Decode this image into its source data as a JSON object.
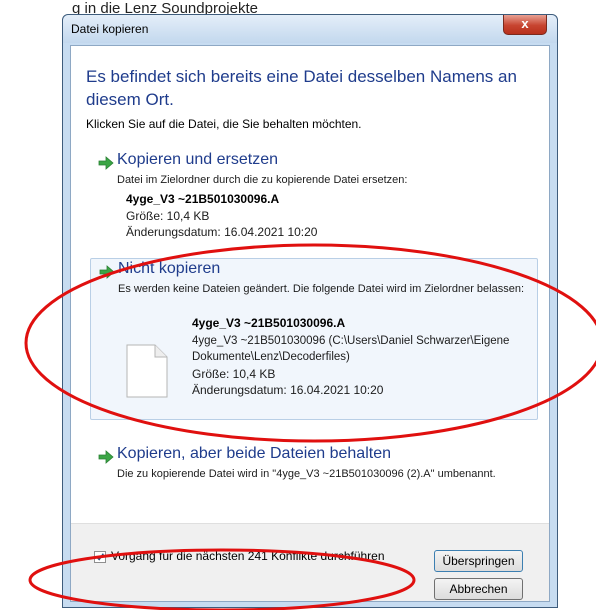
{
  "background": {
    "text": "g in die Lenz Soundprojekte"
  },
  "dialog": {
    "title": "Datei kopieren",
    "close_glyph": "x",
    "heading": "Es befindet sich bereits eine Datei desselben Namens an diesem Ort.",
    "subheading": "Klicken Sie auf die Datei, die Sie behalten möchten.",
    "options": [
      {
        "title": "Kopieren und ersetzen",
        "description": "Datei im Zielordner durch die zu kopierende Datei ersetzen:",
        "file_name": "4yge_V3 ~21B501030096.A",
        "size": "Größe: 10,4 KB",
        "modified": "Änderungsdatum: 16.04.2021 10:20"
      },
      {
        "title": "Nicht kopieren",
        "description": "Es werden keine Dateien geändert. Die folgende Datei wird im Zielordner belassen:",
        "file_name": "4yge_V3 ~21B501030096.A",
        "path": "4yge_V3 ~21B501030096 (C:\\Users\\Daniel Schwarzer\\Eigene Dokumente\\Lenz\\Decoderfiles)",
        "size": "Größe: 10,4 KB",
        "modified": "Änderungsdatum: 16.04.2021 10:20"
      },
      {
        "title": "Kopieren, aber beide Dateien behalten",
        "description": "Die zu kopierende Datei wird in \"4yge_V3 ~21B501030096 (2).A\" umbenannt."
      }
    ],
    "checkbox": {
      "label": "Vorgang für die nächsten 241 Konflikte durchführen",
      "checked": true
    },
    "buttons": {
      "skip": "Überspringen",
      "cancel": "Abbrechen"
    }
  },
  "colors": {
    "accent_text": "#1f3c8c",
    "arrow_green": "#3aa544",
    "annotation_red": "#e0100f"
  },
  "icons": {
    "option_arrow": "green-arrow-icon",
    "file": "document-icon",
    "close": "close-icon"
  }
}
